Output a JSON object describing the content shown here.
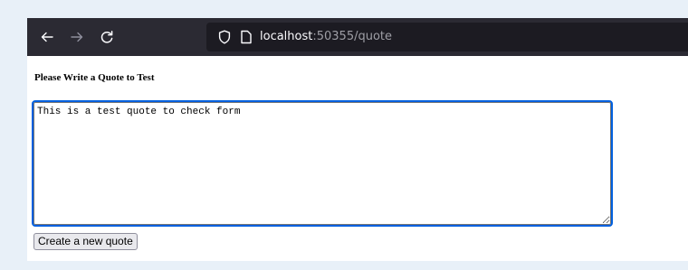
{
  "browser": {
    "nav": {
      "back_icon": "arrow-left-icon",
      "forward_icon": "arrow-right-icon",
      "reload_icon": "reload-icon"
    },
    "address_bar": {
      "host": "localhost",
      "rest": ":50355/quote",
      "security_icon": "shield-icon",
      "page_icon": "page-icon"
    },
    "colors": {
      "toolbar": "#2b2a33",
      "urlbar": "#1c1b22",
      "focus_ring": "#0060df"
    }
  },
  "page": {
    "heading": "Please Write a Quote to Test",
    "quote_value": "This is a test quote to check form",
    "submit_label": "Create a new quote"
  }
}
